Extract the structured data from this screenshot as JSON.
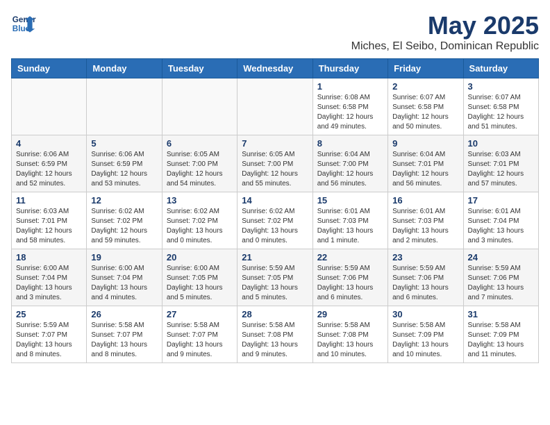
{
  "logo": {
    "line1": "General",
    "line2": "Blue"
  },
  "title": "May 2025",
  "location": "Miches, El Seibo, Dominican Republic",
  "weekdays": [
    "Sunday",
    "Monday",
    "Tuesday",
    "Wednesday",
    "Thursday",
    "Friday",
    "Saturday"
  ],
  "weeks": [
    [
      {
        "day": "",
        "info": ""
      },
      {
        "day": "",
        "info": ""
      },
      {
        "day": "",
        "info": ""
      },
      {
        "day": "",
        "info": ""
      },
      {
        "day": "1",
        "info": "Sunrise: 6:08 AM\nSunset: 6:58 PM\nDaylight: 12 hours\nand 49 minutes."
      },
      {
        "day": "2",
        "info": "Sunrise: 6:07 AM\nSunset: 6:58 PM\nDaylight: 12 hours\nand 50 minutes."
      },
      {
        "day": "3",
        "info": "Sunrise: 6:07 AM\nSunset: 6:58 PM\nDaylight: 12 hours\nand 51 minutes."
      }
    ],
    [
      {
        "day": "4",
        "info": "Sunrise: 6:06 AM\nSunset: 6:59 PM\nDaylight: 12 hours\nand 52 minutes."
      },
      {
        "day": "5",
        "info": "Sunrise: 6:06 AM\nSunset: 6:59 PM\nDaylight: 12 hours\nand 53 minutes."
      },
      {
        "day": "6",
        "info": "Sunrise: 6:05 AM\nSunset: 7:00 PM\nDaylight: 12 hours\nand 54 minutes."
      },
      {
        "day": "7",
        "info": "Sunrise: 6:05 AM\nSunset: 7:00 PM\nDaylight: 12 hours\nand 55 minutes."
      },
      {
        "day": "8",
        "info": "Sunrise: 6:04 AM\nSunset: 7:00 PM\nDaylight: 12 hours\nand 56 minutes."
      },
      {
        "day": "9",
        "info": "Sunrise: 6:04 AM\nSunset: 7:01 PM\nDaylight: 12 hours\nand 56 minutes."
      },
      {
        "day": "10",
        "info": "Sunrise: 6:03 AM\nSunset: 7:01 PM\nDaylight: 12 hours\nand 57 minutes."
      }
    ],
    [
      {
        "day": "11",
        "info": "Sunrise: 6:03 AM\nSunset: 7:01 PM\nDaylight: 12 hours\nand 58 minutes."
      },
      {
        "day": "12",
        "info": "Sunrise: 6:02 AM\nSunset: 7:02 PM\nDaylight: 12 hours\nand 59 minutes."
      },
      {
        "day": "13",
        "info": "Sunrise: 6:02 AM\nSunset: 7:02 PM\nDaylight: 13 hours\nand 0 minutes."
      },
      {
        "day": "14",
        "info": "Sunrise: 6:02 AM\nSunset: 7:02 PM\nDaylight: 13 hours\nand 0 minutes."
      },
      {
        "day": "15",
        "info": "Sunrise: 6:01 AM\nSunset: 7:03 PM\nDaylight: 13 hours\nand 1 minute."
      },
      {
        "day": "16",
        "info": "Sunrise: 6:01 AM\nSunset: 7:03 PM\nDaylight: 13 hours\nand 2 minutes."
      },
      {
        "day": "17",
        "info": "Sunrise: 6:01 AM\nSunset: 7:04 PM\nDaylight: 13 hours\nand 3 minutes."
      }
    ],
    [
      {
        "day": "18",
        "info": "Sunrise: 6:00 AM\nSunset: 7:04 PM\nDaylight: 13 hours\nand 3 minutes."
      },
      {
        "day": "19",
        "info": "Sunrise: 6:00 AM\nSunset: 7:04 PM\nDaylight: 13 hours\nand 4 minutes."
      },
      {
        "day": "20",
        "info": "Sunrise: 6:00 AM\nSunset: 7:05 PM\nDaylight: 13 hours\nand 5 minutes."
      },
      {
        "day": "21",
        "info": "Sunrise: 5:59 AM\nSunset: 7:05 PM\nDaylight: 13 hours\nand 5 minutes."
      },
      {
        "day": "22",
        "info": "Sunrise: 5:59 AM\nSunset: 7:06 PM\nDaylight: 13 hours\nand 6 minutes."
      },
      {
        "day": "23",
        "info": "Sunrise: 5:59 AM\nSunset: 7:06 PM\nDaylight: 13 hours\nand 6 minutes."
      },
      {
        "day": "24",
        "info": "Sunrise: 5:59 AM\nSunset: 7:06 PM\nDaylight: 13 hours\nand 7 minutes."
      }
    ],
    [
      {
        "day": "25",
        "info": "Sunrise: 5:59 AM\nSunset: 7:07 PM\nDaylight: 13 hours\nand 8 minutes."
      },
      {
        "day": "26",
        "info": "Sunrise: 5:58 AM\nSunset: 7:07 PM\nDaylight: 13 hours\nand 8 minutes."
      },
      {
        "day": "27",
        "info": "Sunrise: 5:58 AM\nSunset: 7:07 PM\nDaylight: 13 hours\nand 9 minutes."
      },
      {
        "day": "28",
        "info": "Sunrise: 5:58 AM\nSunset: 7:08 PM\nDaylight: 13 hours\nand 9 minutes."
      },
      {
        "day": "29",
        "info": "Sunrise: 5:58 AM\nSunset: 7:08 PM\nDaylight: 13 hours\nand 10 minutes."
      },
      {
        "day": "30",
        "info": "Sunrise: 5:58 AM\nSunset: 7:09 PM\nDaylight: 13 hours\nand 10 minutes."
      },
      {
        "day": "31",
        "info": "Sunrise: 5:58 AM\nSunset: 7:09 PM\nDaylight: 13 hours\nand 11 minutes."
      }
    ]
  ]
}
